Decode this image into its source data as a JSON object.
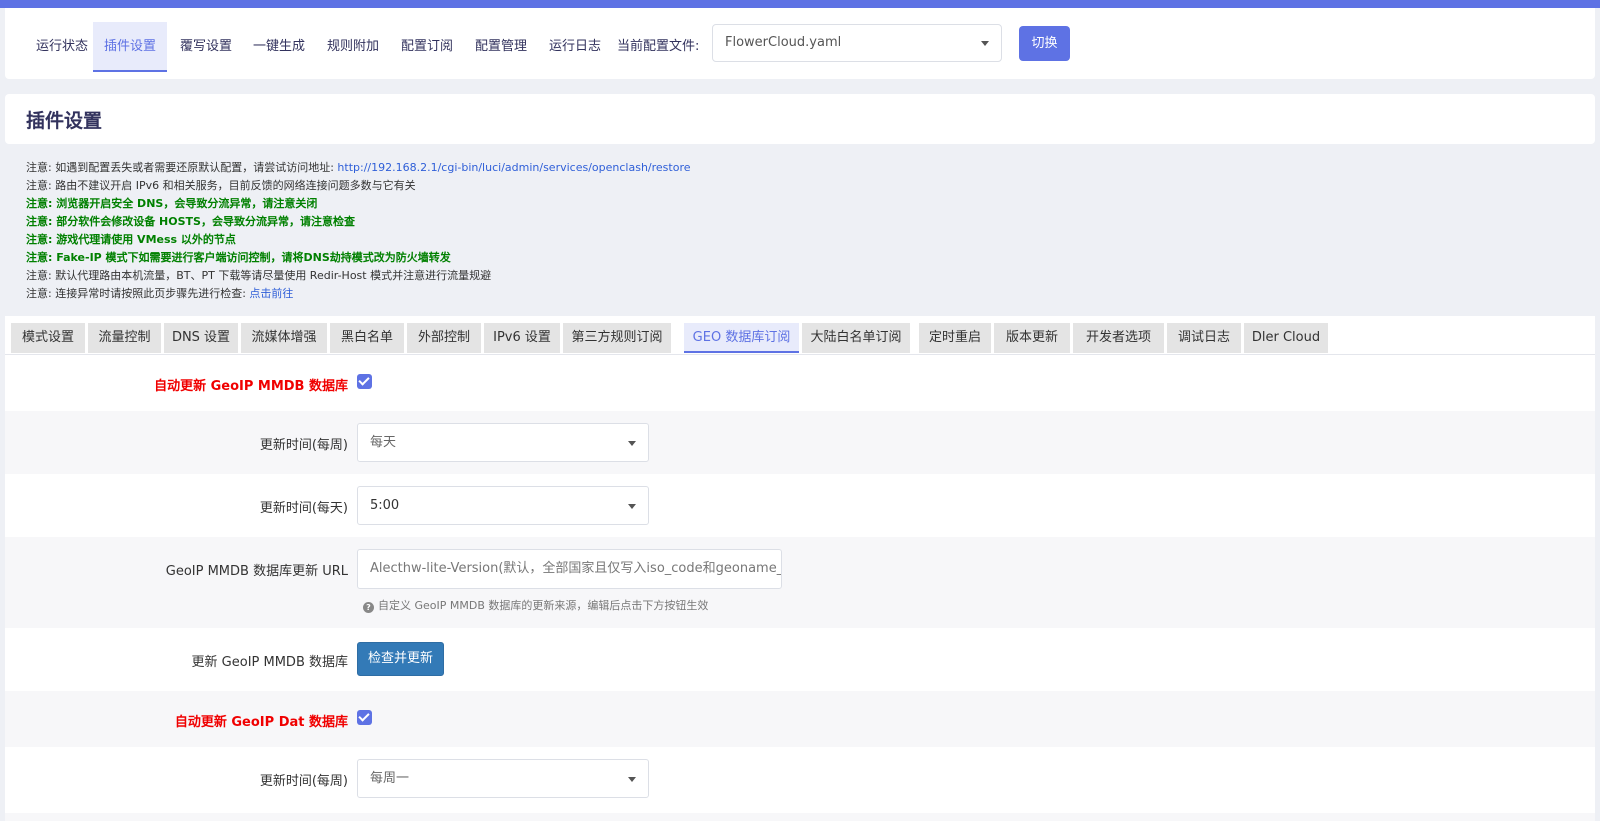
{
  "nav": {
    "items": [
      "运行状态",
      "插件设置",
      "覆写设置",
      "一键生成",
      "规则附加",
      "配置订阅",
      "配置管理",
      "运行日志"
    ],
    "active_index": 1,
    "config_label": "当前配置文件:",
    "config_value": "FlowerCloud.yaml",
    "switch_label": "切换"
  },
  "page_title": "插件设置",
  "notices": [
    {
      "prefix": "注意: 如遇到配置丢失或者需要还原默认配置，请尝试访问地址: ",
      "link": "http://192.168.2.1/cgi-bin/luci/admin/services/openclash/restore"
    },
    {
      "text": "注意: 路由不建议开启 IPv6 和相关服务，目前反馈的网络连接问题多数与它有关"
    },
    {
      "text": "注意: 浏览器开启安全 DNS，会导致分流异常，请注意关闭"
    },
    {
      "text": "注意: 部分软件会修改设备 HOSTS，会导致分流异常，请注意检查"
    },
    {
      "text": "注意: 游戏代理请使用 VMess 以外的节点"
    },
    {
      "text": "注意: Fake-IP 模式下如需要进行客户端访问控制，请将DNS劫持模式改为防火墙转发"
    },
    {
      "text": "注意: 默认代理路由本机流量，BT、PT 下载等请尽量使用 Redir-Host 模式并注意进行流量规避"
    },
    {
      "prefix": "注意: 连接异常时请按照此页步骤先进行检查: ",
      "link": "点击前往"
    }
  ],
  "tabs": [
    "模式设置",
    "流量控制",
    "DNS 设置",
    "流媒体增强",
    "黑白名单",
    "外部控制",
    "IPv6 设置",
    "第三方规则订阅",
    "GEO 数据库订阅",
    "大陆白名单订阅",
    "定时重启",
    "版本更新",
    "开发者选项",
    "调试日志",
    "Dler Cloud"
  ],
  "active_tab_index": 8,
  "form": {
    "auto_update_mmdb_label": "自动更新 GeoIP MMDB 数据库",
    "auto_update_mmdb_checked": true,
    "mmdb_week_label": "更新时间(每周)",
    "mmdb_week_value": "每天",
    "mmdb_day_label": "更新时间(每天)",
    "mmdb_day_value": "5:00",
    "mmdb_url_label": "GeoIP MMDB 数据库更新 URL",
    "mmdb_url_value": "Alecthw-lite-Version(默认，全部国家且仅写入iso_code和geoname_id)",
    "mmdb_url_hint": "自定义 GeoIP MMDB 数据库的更新来源，编辑后点击下方按钮生效",
    "update_mmdb_label": "更新 GeoIP MMDB 数据库",
    "update_mmdb_button": "检查并更新",
    "auto_update_dat_label": "自动更新 GeoIP Dat 数据库",
    "auto_update_dat_checked": true,
    "dat_week_label": "更新时间(每周)",
    "dat_week_value": "每周一"
  },
  "colors": {
    "accent": "#5e72e4",
    "warning_red": "#f00000",
    "notice_green": "#008000",
    "button_blue": "#337ab7"
  }
}
